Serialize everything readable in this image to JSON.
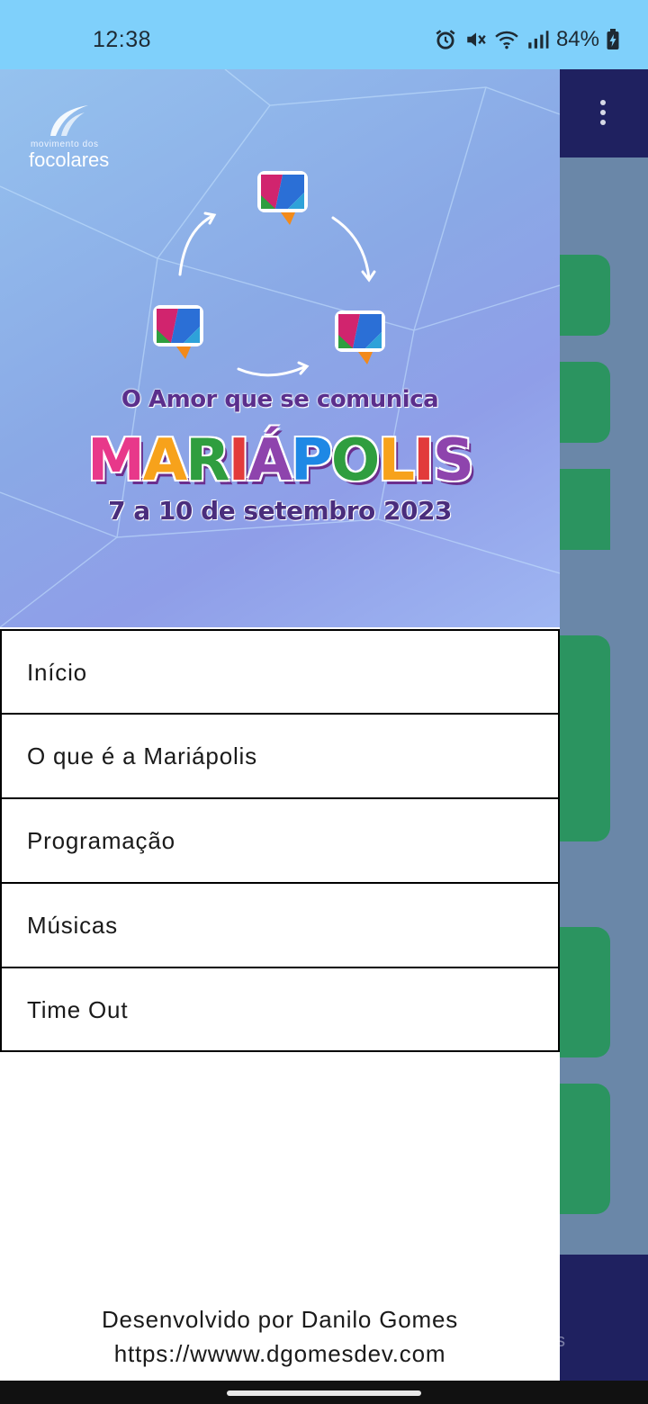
{
  "status_bar": {
    "time": "12:38",
    "battery": "84%",
    "icons": [
      "alarm-icon",
      "mute-icon",
      "wifi-icon",
      "signal-icon",
      "battery-charging-icon"
    ]
  },
  "banner": {
    "logo_small": "movimento dos",
    "logo_big": "focolares",
    "tagline": "O Amor que se comunica",
    "title_letters": [
      "M",
      "A",
      "R",
      "I",
      "Á",
      "P",
      "O",
      "L",
      "I",
      "S"
    ],
    "title_colors": [
      "#e8388a",
      "#f7a21b",
      "#2f9e3f",
      "#e23b3b",
      "#8e44ad",
      "#1e88e5",
      "#2f9e3f",
      "#f7a21b",
      "#e23b3b",
      "#8e44ad"
    ],
    "dates": "7 a 10 de setembro 2023"
  },
  "menu": {
    "items": [
      {
        "label": "Início"
      },
      {
        "label": "O que é a Mariápolis"
      },
      {
        "label": "Programação"
      },
      {
        "label": "Músicas"
      },
      {
        "label": "Time Out"
      }
    ]
  },
  "footer": {
    "line1": "Desenvolvido por Danilo Gomes",
    "line2": "https://wwww.dgomesdev.com"
  },
  "background_app": {
    "bottom_nav_partial_text": "s"
  },
  "colors": {
    "status_bar": "#7fd0fb",
    "app_header": "#1f2160",
    "card_green": "#2b9460",
    "scrim_body": "#6a87a8"
  }
}
